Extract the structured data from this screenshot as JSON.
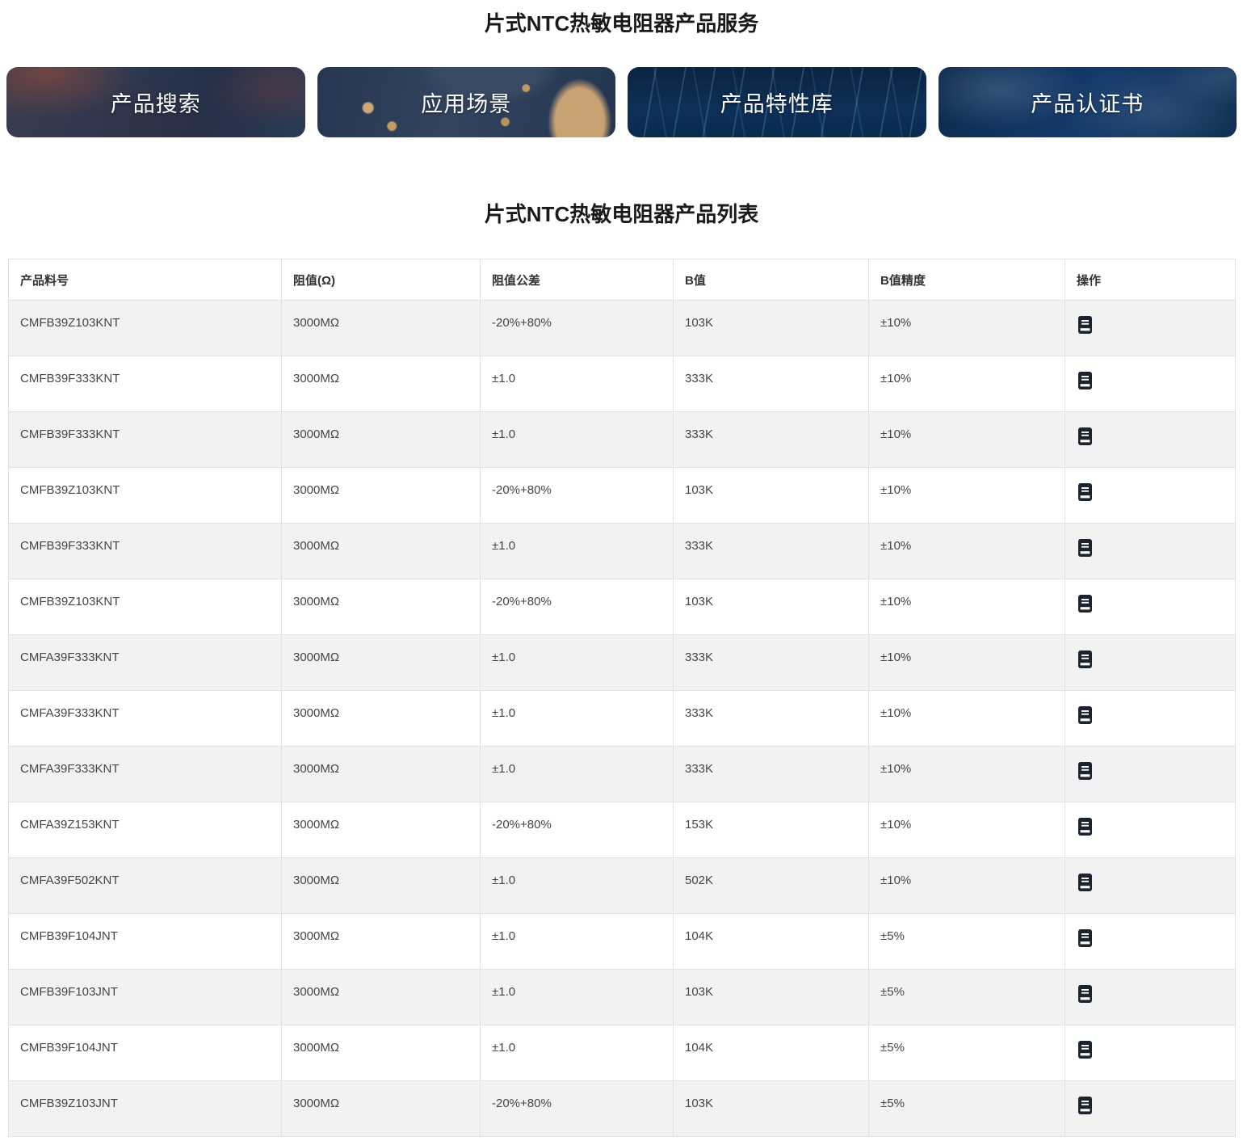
{
  "page": {
    "service_title": "片式NTC热敏电阻器产品服务",
    "list_title": "片式NTC热敏电阻器产品列表"
  },
  "banners": [
    {
      "label": "产品搜索",
      "icon": "circuit-blur-photo"
    },
    {
      "label": "应用场景",
      "icon": "circuit-board-photo"
    },
    {
      "label": "产品特性库",
      "icon": "light-rays-photo"
    },
    {
      "label": "产品认证书",
      "icon": "world-map-photo"
    }
  ],
  "table": {
    "columns": [
      "产品料号",
      "阻值(Ω)",
      "阻值公差",
      "B值",
      "B值精度",
      "操作"
    ],
    "action_icon": "datasheet-icon",
    "rows": [
      {
        "part_number": "CMFB39Z103KNT",
        "resistance": "3000MΩ",
        "tolerance": "-20%+80%",
        "b_value": "103K",
        "b_precision": "±10%"
      },
      {
        "part_number": "CMFB39F333KNT",
        "resistance": "3000MΩ",
        "tolerance": "±1.0",
        "b_value": "333K",
        "b_precision": "±10%"
      },
      {
        "part_number": "CMFB39F333KNT",
        "resistance": "3000MΩ",
        "tolerance": "±1.0",
        "b_value": "333K",
        "b_precision": "±10%"
      },
      {
        "part_number": "CMFB39Z103KNT",
        "resistance": "3000MΩ",
        "tolerance": "-20%+80%",
        "b_value": "103K",
        "b_precision": "±10%"
      },
      {
        "part_number": "CMFB39F333KNT",
        "resistance": "3000MΩ",
        "tolerance": "±1.0",
        "b_value": "333K",
        "b_precision": "±10%"
      },
      {
        "part_number": "CMFB39Z103KNT",
        "resistance": "3000MΩ",
        "tolerance": "-20%+80%",
        "b_value": "103K",
        "b_precision": "±10%"
      },
      {
        "part_number": "CMFA39F333KNT",
        "resistance": "3000MΩ",
        "tolerance": "±1.0",
        "b_value": "333K",
        "b_precision": "±10%"
      },
      {
        "part_number": "CMFA39F333KNT",
        "resistance": "3000MΩ",
        "tolerance": "±1.0",
        "b_value": "333K",
        "b_precision": "±10%"
      },
      {
        "part_number": "CMFA39F333KNT",
        "resistance": "3000MΩ",
        "tolerance": "±1.0",
        "b_value": "333K",
        "b_precision": "±10%"
      },
      {
        "part_number": "CMFA39Z153KNT",
        "resistance": "3000MΩ",
        "tolerance": "-20%+80%",
        "b_value": "153K",
        "b_precision": "±10%"
      },
      {
        "part_number": "CMFA39F502KNT",
        "resistance": "3000MΩ",
        "tolerance": "±1.0",
        "b_value": "502K",
        "b_precision": "±10%"
      },
      {
        "part_number": "CMFB39F104JNT",
        "resistance": "3000MΩ",
        "tolerance": "±1.0",
        "b_value": "104K",
        "b_precision": "±5%"
      },
      {
        "part_number": "CMFB39F103JNT",
        "resistance": "3000MΩ",
        "tolerance": "±1.0",
        "b_value": "103K",
        "b_precision": "±5%"
      },
      {
        "part_number": "CMFB39F104JNT",
        "resistance": "3000MΩ",
        "tolerance": "±1.0",
        "b_value": "104K",
        "b_precision": "±5%"
      },
      {
        "part_number": "CMFB39Z103JNT",
        "resistance": "3000MΩ",
        "tolerance": "-20%+80%",
        "b_value": "103K",
        "b_precision": "±5%"
      }
    ]
  },
  "colors": {
    "stripe_row": "#f2f2f2",
    "table_border": "#dee2e6",
    "heading_text": "#1a1a1a",
    "cell_text": "#454545",
    "banner_text": "#ffffff",
    "icon_dark": "#1b2330"
  }
}
